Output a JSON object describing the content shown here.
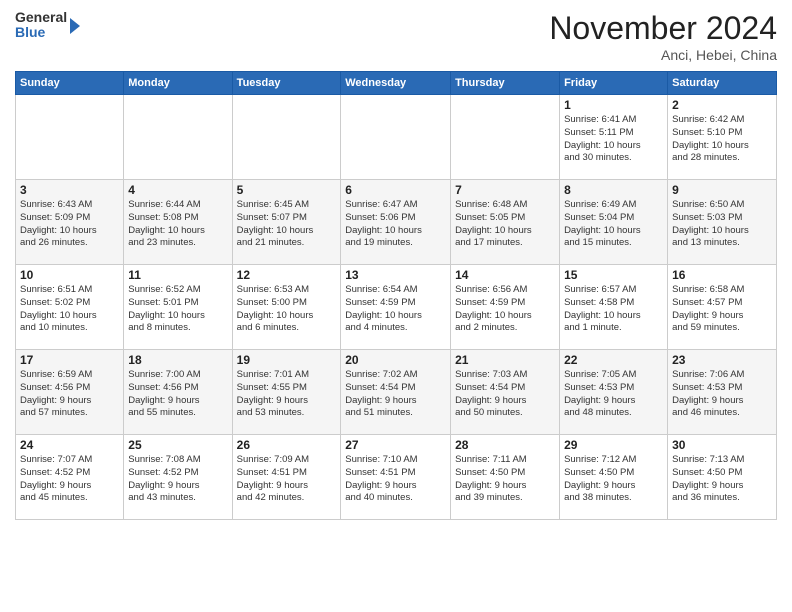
{
  "header": {
    "logo_line1": "General",
    "logo_line2": "Blue",
    "month": "November 2024",
    "location": "Anci, Hebei, China"
  },
  "days_of_week": [
    "Sunday",
    "Monday",
    "Tuesday",
    "Wednesday",
    "Thursday",
    "Friday",
    "Saturday"
  ],
  "weeks": [
    [
      {
        "day": "",
        "info": ""
      },
      {
        "day": "",
        "info": ""
      },
      {
        "day": "",
        "info": ""
      },
      {
        "day": "",
        "info": ""
      },
      {
        "day": "",
        "info": ""
      },
      {
        "day": "1",
        "info": "Sunrise: 6:41 AM\nSunset: 5:11 PM\nDaylight: 10 hours\nand 30 minutes."
      },
      {
        "day": "2",
        "info": "Sunrise: 6:42 AM\nSunset: 5:10 PM\nDaylight: 10 hours\nand 28 minutes."
      }
    ],
    [
      {
        "day": "3",
        "info": "Sunrise: 6:43 AM\nSunset: 5:09 PM\nDaylight: 10 hours\nand 26 minutes."
      },
      {
        "day": "4",
        "info": "Sunrise: 6:44 AM\nSunset: 5:08 PM\nDaylight: 10 hours\nand 23 minutes."
      },
      {
        "day": "5",
        "info": "Sunrise: 6:45 AM\nSunset: 5:07 PM\nDaylight: 10 hours\nand 21 minutes."
      },
      {
        "day": "6",
        "info": "Sunrise: 6:47 AM\nSunset: 5:06 PM\nDaylight: 10 hours\nand 19 minutes."
      },
      {
        "day": "7",
        "info": "Sunrise: 6:48 AM\nSunset: 5:05 PM\nDaylight: 10 hours\nand 17 minutes."
      },
      {
        "day": "8",
        "info": "Sunrise: 6:49 AM\nSunset: 5:04 PM\nDaylight: 10 hours\nand 15 minutes."
      },
      {
        "day": "9",
        "info": "Sunrise: 6:50 AM\nSunset: 5:03 PM\nDaylight: 10 hours\nand 13 minutes."
      }
    ],
    [
      {
        "day": "10",
        "info": "Sunrise: 6:51 AM\nSunset: 5:02 PM\nDaylight: 10 hours\nand 10 minutes."
      },
      {
        "day": "11",
        "info": "Sunrise: 6:52 AM\nSunset: 5:01 PM\nDaylight: 10 hours\nand 8 minutes."
      },
      {
        "day": "12",
        "info": "Sunrise: 6:53 AM\nSunset: 5:00 PM\nDaylight: 10 hours\nand 6 minutes."
      },
      {
        "day": "13",
        "info": "Sunrise: 6:54 AM\nSunset: 4:59 PM\nDaylight: 10 hours\nand 4 minutes."
      },
      {
        "day": "14",
        "info": "Sunrise: 6:56 AM\nSunset: 4:59 PM\nDaylight: 10 hours\nand 2 minutes."
      },
      {
        "day": "15",
        "info": "Sunrise: 6:57 AM\nSunset: 4:58 PM\nDaylight: 10 hours\nand 1 minute."
      },
      {
        "day": "16",
        "info": "Sunrise: 6:58 AM\nSunset: 4:57 PM\nDaylight: 9 hours\nand 59 minutes."
      }
    ],
    [
      {
        "day": "17",
        "info": "Sunrise: 6:59 AM\nSunset: 4:56 PM\nDaylight: 9 hours\nand 57 minutes."
      },
      {
        "day": "18",
        "info": "Sunrise: 7:00 AM\nSunset: 4:56 PM\nDaylight: 9 hours\nand 55 minutes."
      },
      {
        "day": "19",
        "info": "Sunrise: 7:01 AM\nSunset: 4:55 PM\nDaylight: 9 hours\nand 53 minutes."
      },
      {
        "day": "20",
        "info": "Sunrise: 7:02 AM\nSunset: 4:54 PM\nDaylight: 9 hours\nand 51 minutes."
      },
      {
        "day": "21",
        "info": "Sunrise: 7:03 AM\nSunset: 4:54 PM\nDaylight: 9 hours\nand 50 minutes."
      },
      {
        "day": "22",
        "info": "Sunrise: 7:05 AM\nSunset: 4:53 PM\nDaylight: 9 hours\nand 48 minutes."
      },
      {
        "day": "23",
        "info": "Sunrise: 7:06 AM\nSunset: 4:53 PM\nDaylight: 9 hours\nand 46 minutes."
      }
    ],
    [
      {
        "day": "24",
        "info": "Sunrise: 7:07 AM\nSunset: 4:52 PM\nDaylight: 9 hours\nand 45 minutes."
      },
      {
        "day": "25",
        "info": "Sunrise: 7:08 AM\nSunset: 4:52 PM\nDaylight: 9 hours\nand 43 minutes."
      },
      {
        "day": "26",
        "info": "Sunrise: 7:09 AM\nSunset: 4:51 PM\nDaylight: 9 hours\nand 42 minutes."
      },
      {
        "day": "27",
        "info": "Sunrise: 7:10 AM\nSunset: 4:51 PM\nDaylight: 9 hours\nand 40 minutes."
      },
      {
        "day": "28",
        "info": "Sunrise: 7:11 AM\nSunset: 4:50 PM\nDaylight: 9 hours\nand 39 minutes."
      },
      {
        "day": "29",
        "info": "Sunrise: 7:12 AM\nSunset: 4:50 PM\nDaylight: 9 hours\nand 38 minutes."
      },
      {
        "day": "30",
        "info": "Sunrise: 7:13 AM\nSunset: 4:50 PM\nDaylight: 9 hours\nand 36 minutes."
      }
    ]
  ]
}
